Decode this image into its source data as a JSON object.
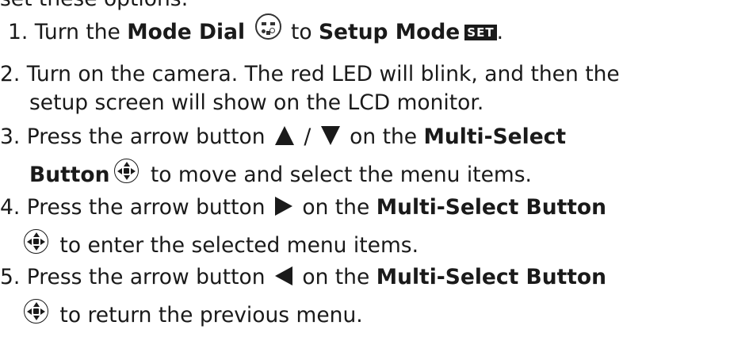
{
  "intro_cut": "set these options:",
  "steps": [
    {
      "num": "1.",
      "pre": "Turn the ",
      "bold1": "Mode Dial",
      "mid": " to ",
      "bold2": "Setup Mode",
      "badge": "SET",
      "post": "."
    },
    {
      "num": "2.",
      "line1": "Turn on the camera. The red LED will blink, and then the",
      "line2": "setup screen will show on the LCD monitor."
    },
    {
      "num": "3.",
      "pre": "Press the arrow button ",
      "slash": " / ",
      "mid": " on the ",
      "bold1": "Multi-Select",
      "bold2": "Button",
      "post": " to move and select the menu items."
    },
    {
      "num": "4.",
      "pre": "Press the arrow button ",
      "mid": " on the ",
      "bold1": "Multi-Select Button",
      "post": " to enter the selected menu items."
    },
    {
      "num": "5.",
      "pre": "Press the arrow button ",
      "mid": " on the ",
      "bold1": "Multi-Select Button",
      "post": " to return the previous menu."
    }
  ],
  "icons": {
    "mode_dial": "mode-dial-icon",
    "set_badge": "set-mode-badge",
    "up": "arrow-up-icon",
    "down": "arrow-down-icon",
    "right": "arrow-right-icon",
    "left": "arrow-left-icon",
    "multi_select": "multi-select-button-icon"
  },
  "colors": {
    "text": "#1a1a1a",
    "background": "#ffffff"
  }
}
